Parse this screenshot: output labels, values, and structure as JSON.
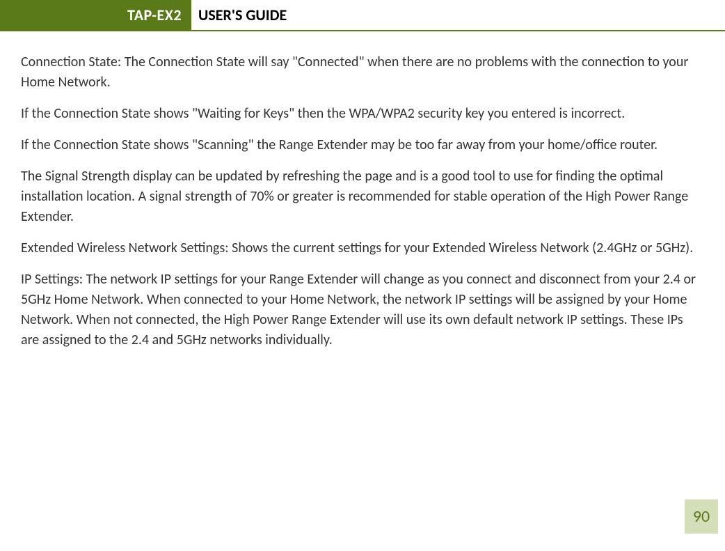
{
  "header": {
    "badge": "TAP-EX2",
    "title": "USER'S GUIDE"
  },
  "paragraphs": [
    "Connection State: The Connection State will say \"Connected\" when there are no problems with the connection to your Home Network.",
    "If the Connection State shows \"Waiting for Keys\" then the WPA/WPA2 security key you entered is incorrect.",
    "If the Connection State shows \"Scanning\" the Range Extender may be too far away from your home/office router.",
    "The Signal Strength display can be updated by refreshing the page and is a good tool to use for finding the optimal installation location. A signal strength of 70% or greater is recommended for stable operation of the High Power Range Extender.",
    "Extended Wireless Network Settings: Shows the current settings for your Extended Wireless Network (2.4GHz or 5GHz).",
    "IP Settings:  The network IP settings for your Range Extender will change as you connect and disconnect from your 2.4 or 5GHz Home Network. When connected to your Home Network, the network IP settings will be assigned by your Home Network. When not connected, the High Power Range Extender will use its own default network IP settings.  These IPs are assigned to the 2.4 and 5GHz networks individually."
  ],
  "page_number": "90",
  "colors": {
    "accent": "#5a7a1a",
    "badge_bg": "#d3dfb8"
  }
}
